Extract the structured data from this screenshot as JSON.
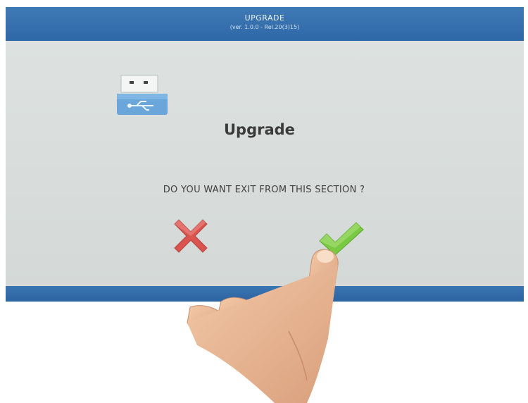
{
  "header": {
    "title": "UPGRADE",
    "version": "(ver. 1.0.0 - Rel.20(3)15)"
  },
  "dialog": {
    "heading": "Upgrade",
    "question": "DO YOU WANT EXIT FROM THIS SECTION ?",
    "icon": "usb-drive-icon",
    "cancel_icon": "red-x-icon",
    "confirm_icon": "green-check-icon"
  },
  "colors": {
    "bar_blue": "#3a75b2",
    "background": "#d9dedc",
    "cancel_red": "#d9534f",
    "confirm_green": "#7ac943"
  }
}
